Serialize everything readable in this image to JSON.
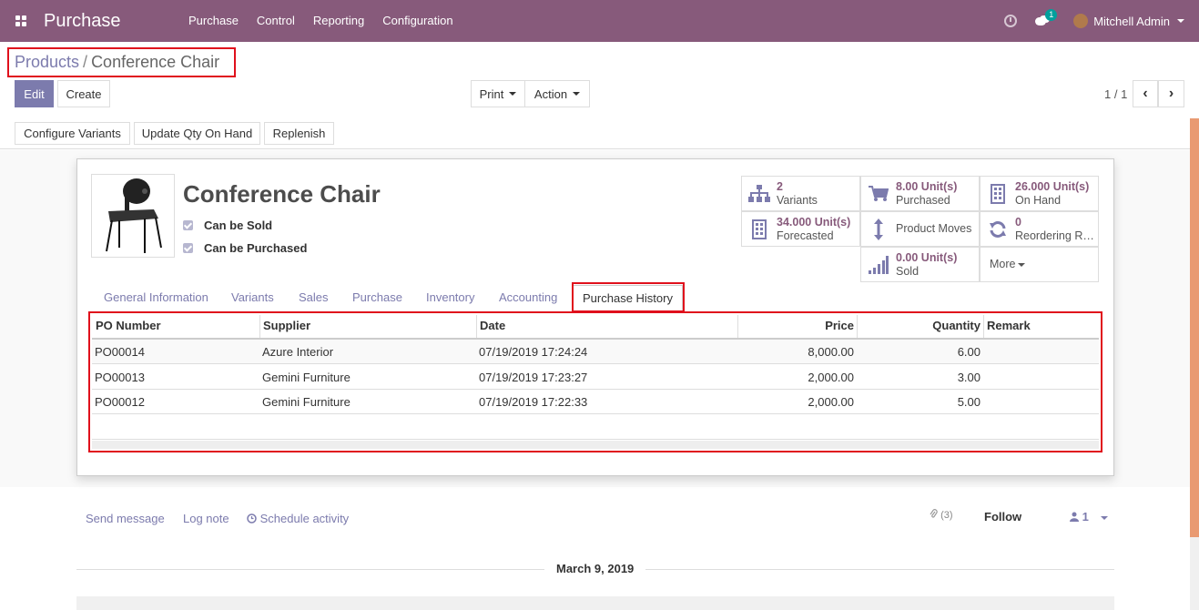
{
  "navbar": {
    "app_title": "Purchase",
    "menu": [
      "Purchase",
      "Control",
      "Reporting",
      "Configuration"
    ],
    "chat_count": "1",
    "user_name": "Mitchell Admin"
  },
  "breadcrumb": {
    "parent": "Products",
    "separator": "/",
    "current": "Conference Chair"
  },
  "buttons": {
    "edit": "Edit",
    "create": "Create",
    "print": "Print",
    "action": "Action",
    "pager": "1 / 1",
    "prev": "‹",
    "next": "›"
  },
  "status_buttons": [
    "Configure Variants",
    "Update Qty On Hand",
    "Replenish"
  ],
  "product": {
    "name": "Conference Chair",
    "can_be_sold": "Can be Sold",
    "can_be_purchased": "Can be Purchased"
  },
  "smart_buttons": {
    "variants": {
      "value": "2",
      "label": "Variants",
      "icon": "sitemap-icon"
    },
    "purchased": {
      "value": "8.00 Unit(s)",
      "label": "Purchased",
      "icon": "cart-icon"
    },
    "on_hand": {
      "value": "26.000 Unit(s)",
      "label": "On Hand",
      "icon": "building-icon"
    },
    "forecasted": {
      "value": "34.000 Unit(s)",
      "label": "Forecasted",
      "icon": "building-icon"
    },
    "moves": {
      "label": "Product Moves",
      "icon": "updown-arrows-icon"
    },
    "reordering": {
      "value": "0",
      "label": "Reordering R…",
      "icon": "refresh-icon"
    },
    "sold": {
      "value": "0.00 Unit(s)",
      "label": "Sold",
      "icon": "signal-icon"
    },
    "more": "More"
  },
  "tabs": [
    "General Information",
    "Variants",
    "Sales",
    "Purchase",
    "Inventory",
    "Accounting",
    "Purchase History"
  ],
  "history_table": {
    "headers": [
      "PO Number",
      "Supplier",
      "Date",
      "Price",
      "Quantity",
      "Remark"
    ],
    "rows": [
      [
        "PO00014",
        "Azure Interior",
        "07/19/2019 17:24:24",
        "8,000.00",
        "6.00",
        ""
      ],
      [
        "PO00013",
        "Gemini Furniture",
        "07/19/2019 17:23:27",
        "2,000.00",
        "3.00",
        ""
      ],
      [
        "PO00012",
        "Gemini Furniture",
        "07/19/2019 17:22:33",
        "2,000.00",
        "5.00",
        ""
      ]
    ]
  },
  "chatter": {
    "send_message": "Send message",
    "log_note": "Log note",
    "schedule_activity": "Schedule activity",
    "attachments": "(3)",
    "follow": "Follow",
    "followers": "1",
    "date_separator": "March 9, 2019"
  },
  "colors": {
    "brand": "#875a7b",
    "link": "#7c7bad",
    "highlight": "#e0101c"
  }
}
